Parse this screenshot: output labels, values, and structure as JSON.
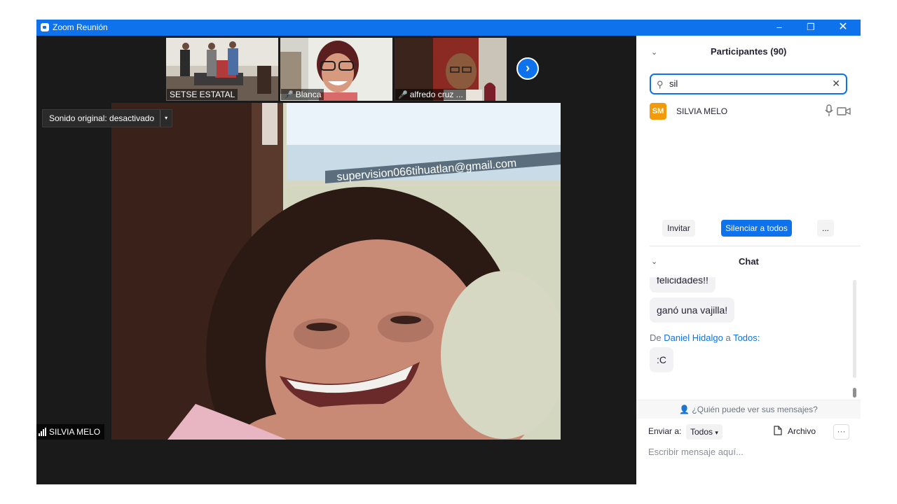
{
  "window": {
    "title": "Zoom Reunión",
    "controls": {
      "minimize": "–",
      "restore": "❐",
      "close": "✕"
    }
  },
  "video": {
    "thumbnails": [
      {
        "name": "SETSE ESTATAL",
        "muted": false
      },
      {
        "name": "Blanca",
        "muted": true
      },
      {
        "name": "alfredo cruz ...",
        "muted": true
      }
    ],
    "next_icon": "›",
    "sound_button": "Sonido original: desactivado",
    "sound_arrow": "▾",
    "main_speaker": "SILVIA MELO",
    "email_sign": "supervision066tihuatlan@gmail.com"
  },
  "participants": {
    "header": "Participantes (90)",
    "search": {
      "value": "sil",
      "clear_icon": "✕"
    },
    "list": [
      {
        "initials": "SM",
        "name": "SILVIA MELO",
        "avatar_color": "#f29a0a"
      }
    ],
    "invite_label": "Invitar",
    "mute_all_label": "Silenciar a todos",
    "more_label": "..."
  },
  "chat": {
    "header": "Chat",
    "messages": [
      "felicidades!!",
      "ganó una vajilla!"
    ],
    "from_prefix": "De",
    "sender": "Daniel Hidalgo",
    "to_word": "a",
    "recipient": "Todos:",
    "last_message": ":C",
    "who_can_see": "¿Quién puede ver sus mensajes?",
    "send_to_label": "Enviar a:",
    "send_to_value": "Todos",
    "file_label": "Archivo",
    "more_label": "···",
    "input_placeholder": "Escribir mensaje aquí..."
  },
  "colors": {
    "accent": "#0e72ed",
    "muted_red": "#e02828"
  }
}
